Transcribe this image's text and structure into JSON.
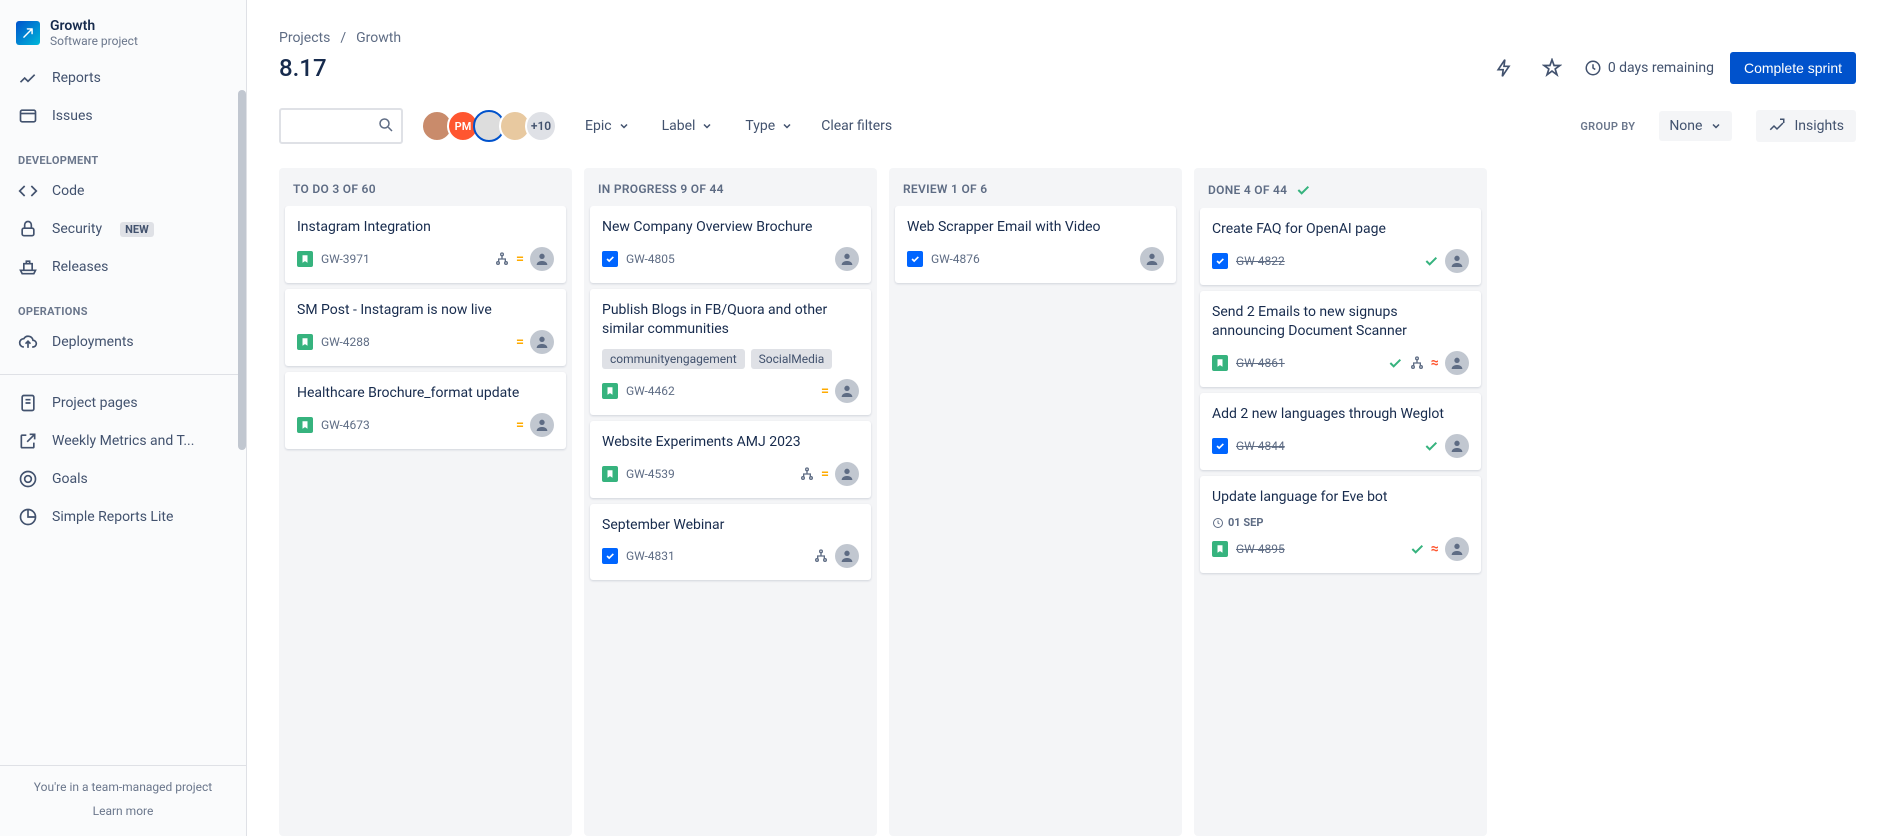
{
  "project": {
    "title": "Growth",
    "subtitle": "Software project"
  },
  "sidebar": {
    "sectionDev": "DEVELOPMENT",
    "sectionOps": "OPERATIONS",
    "items": {
      "reports": "Reports",
      "issues": "Issues",
      "code": "Code",
      "security": "Security",
      "securityBadge": "NEW",
      "releases": "Releases",
      "deployments": "Deployments",
      "projectPages": "Project pages",
      "weeklyMetrics": "Weekly Metrics and T...",
      "goals": "Goals",
      "simpleReports": "Simple Reports Lite"
    },
    "footer1": "You're in a team-managed project",
    "footer2": "Learn more"
  },
  "breadcrumb": {
    "projects": "Projects",
    "current": "Growth"
  },
  "sprint": {
    "name": "8.17",
    "daysRemaining": "0 days remaining",
    "completeBtn": "Complete sprint"
  },
  "filters": {
    "epic": "Epic",
    "label": "Label",
    "type": "Type",
    "clear": "Clear filters",
    "groupByLabel": "GROUP BY",
    "groupByValue": "None",
    "insights": "Insights",
    "avatarMore": "+10",
    "avatarPM": "PM"
  },
  "columns": [
    {
      "id": "todo",
      "title": "TO DO 3 OF 60"
    },
    {
      "id": "inprogress",
      "title": "IN PROGRESS 9 OF 44"
    },
    {
      "id": "review",
      "title": "REVIEW 1 OF 6"
    },
    {
      "id": "done",
      "title": "DONE 4 OF 44"
    }
  ],
  "cards": {
    "todo": [
      {
        "title": "Instagram Integration",
        "key": "GW-3971",
        "type": "story",
        "right": [
          "children",
          "medium",
          "assignee"
        ]
      },
      {
        "title": "SM Post - Instagram is now live",
        "key": "GW-4288",
        "type": "story",
        "right": [
          "medium",
          "assignee"
        ]
      },
      {
        "title": "Healthcare Brochure_format update",
        "key": "GW-4673",
        "type": "story",
        "right": [
          "medium",
          "assignee"
        ]
      }
    ],
    "inprogress": [
      {
        "title": "New Company Overview Brochure",
        "key": "GW-4805",
        "type": "task",
        "right": [
          "assignee"
        ]
      },
      {
        "title": "Publish Blogs in FB/Quora and other similar communities",
        "key": "GW-4462",
        "type": "story",
        "labels": [
          "communityengagement",
          "SocialMedia"
        ],
        "right": [
          "medium",
          "assignee"
        ]
      },
      {
        "title": "Website Experiments AMJ 2023",
        "key": "GW-4539",
        "type": "story",
        "right": [
          "children",
          "medium",
          "assignee"
        ]
      },
      {
        "title": "September Webinar",
        "key": "GW-4831",
        "type": "task",
        "right": [
          "children",
          "assignee"
        ]
      }
    ],
    "review": [
      {
        "title": "Web Scrapper Email with Video",
        "key": "GW-4876",
        "type": "task",
        "right": [
          "assignee"
        ]
      }
    ],
    "done": [
      {
        "title": "Create FAQ for OpenAI page",
        "key": "GW-4822",
        "type": "task",
        "done": true,
        "right": [
          "check",
          "assignee"
        ]
      },
      {
        "title": "Send 2 Emails to new signups announcing Document Scanner",
        "key": "GW-4861",
        "type": "story",
        "done": true,
        "right": [
          "check",
          "children",
          "highest",
          "assignee"
        ]
      },
      {
        "title": "Add 2 new languages through Weglot",
        "key": "GW-4844",
        "type": "task",
        "done": true,
        "right": [
          "check",
          "assignee"
        ]
      },
      {
        "title": "Update language for Eve bot",
        "key": "GW-4895",
        "type": "story",
        "done": true,
        "date": "01 SEP",
        "right": [
          "check",
          "highest",
          "assignee"
        ]
      }
    ]
  }
}
